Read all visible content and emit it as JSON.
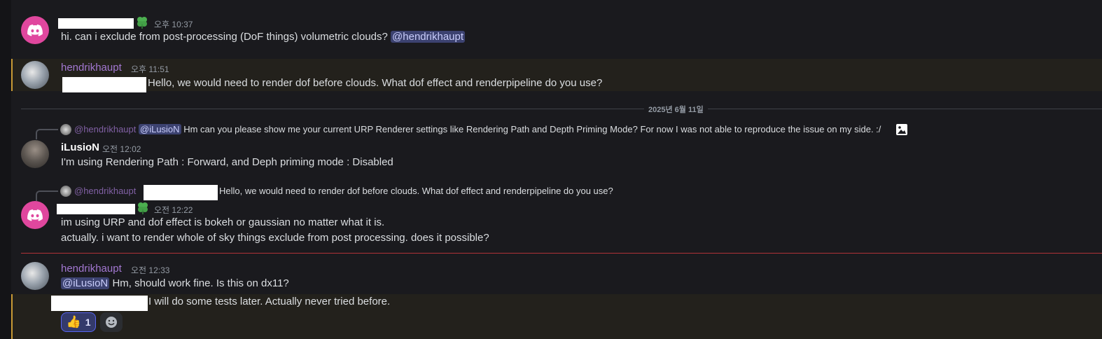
{
  "messages": [
    {
      "timestamp": "오후 10:37",
      "text": "hi. can i exclude from post-processing (DoF things) volumetric clouds?",
      "mention": "@hendrikhaupt"
    },
    {
      "author": "hendrikhaupt",
      "timestamp": "오후 11:51",
      "text": "Hello, we would need to render dof before clouds.  What dof effect and renderpipeline do you use?"
    },
    {
      "author": "iLusioN",
      "timestamp": "오전 12:02",
      "reply": {
        "author": "@hendrikhaupt",
        "mention": "@iLusioN",
        "text": "Hm can you please show me your current URP Renderer settings like Rendering Path and Depth Priming Mode? For now I was not able to reproduce the issue on my side. :/"
      },
      "text": "I'm using Rendering Path : Forward, and Deph priming mode : Disabled"
    },
    {
      "timestamp": "오전 12:22",
      "reply": {
        "author": "@hendrikhaupt",
        "text": "Hello, we would need to render dof before clouds.  What dof effect and renderpipeline do you use?"
      },
      "lines": [
        "im using URP and dof effect is bokeh or gaussian no matter what it is.",
        "actually. i want to render whole of sky things exclude from post processing. does it possible?"
      ]
    },
    {
      "author": "hendrikhaupt",
      "timestamp": "오전 12:33",
      "mention": "@iLusioN",
      "text": "Hm, should work fine. Is this on dx11?",
      "followup": "I will do some tests later. Actually never tried before.",
      "reaction": {
        "emoji": "👍",
        "count": "1"
      }
    }
  ],
  "date_divider": "2025년 6월 11일",
  "colors": {
    "background": "#1a1a1e",
    "username": "#a277d0",
    "mention_bg": "#3c4270",
    "highlight_border": "#c99a35",
    "new_divider": "#f23f43"
  }
}
